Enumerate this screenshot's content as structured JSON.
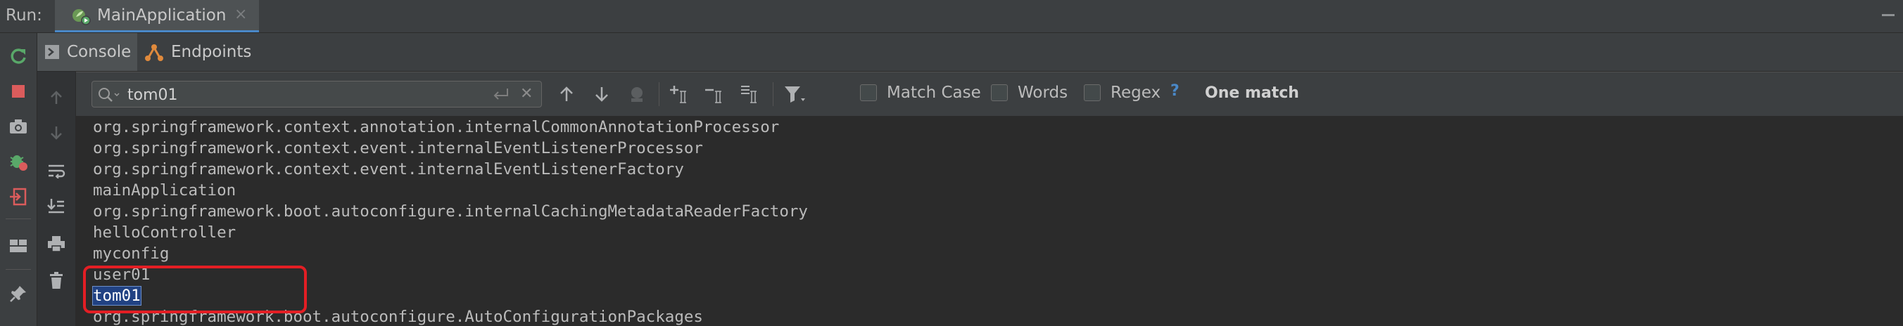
{
  "runbar": {
    "label": "Run:",
    "tab_title": "MainApplication",
    "tab_close": "×"
  },
  "subtabs": {
    "console": "Console",
    "endpoints": "Endpoints"
  },
  "search": {
    "query": "tom01",
    "match_case": "Match Case",
    "words": "Words",
    "regex": "Regex",
    "help": "?",
    "status": "One match"
  },
  "console": {
    "lines": [
      "org.springframework.context.annotation.internalCommonAnnotationProcessor",
      "org.springframework.context.event.internalEventListenerProcessor",
      "org.springframework.context.event.internalEventListenerFactory",
      "mainApplication",
      "org.springframework.boot.autoconfigure.internalCachingMetadataReaderFactory",
      "helloController",
      "myconfig",
      "user01",
      "tom01",
      "org.springframework.boot.autoconfigure.AutoConfigurationPackages"
    ]
  },
  "colors": {
    "background": "#2b2b2b",
    "panel": "#3c3f41",
    "accent": "#4a88c7",
    "highlight": "#214283",
    "annotation": "#e31e24",
    "rerun": "#59a869",
    "stop": "#db5c5c"
  },
  "icons": {
    "run_tab": "spring-boot-run-icon",
    "rerun": "rerun-icon",
    "stop": "stop-icon",
    "dump_threads": "camera-icon",
    "debug": "bug-icon",
    "exit": "exit-icon",
    "layout": "layout-icon",
    "pin": "pin-icon",
    "console_tab": "console-icon",
    "endpoints_tab": "endpoints-icon",
    "up": "arrow-up-icon",
    "down": "arrow-down-icon",
    "soft_wrap": "soft-wrap-icon",
    "scroll_end": "scroll-to-end-icon",
    "print": "print-icon",
    "trash": "trash-icon",
    "search": "search-icon",
    "newline": "newline-icon",
    "clear": "clear-icon",
    "prev": "previous-occurrence-icon",
    "next": "next-occurrence-icon",
    "find_all": "find-all-icon",
    "add_selection": "add-selection-icon",
    "remove_selection": "remove-selection-icon",
    "select_all": "select-all-occurrences-icon",
    "filter": "filter-icon"
  }
}
